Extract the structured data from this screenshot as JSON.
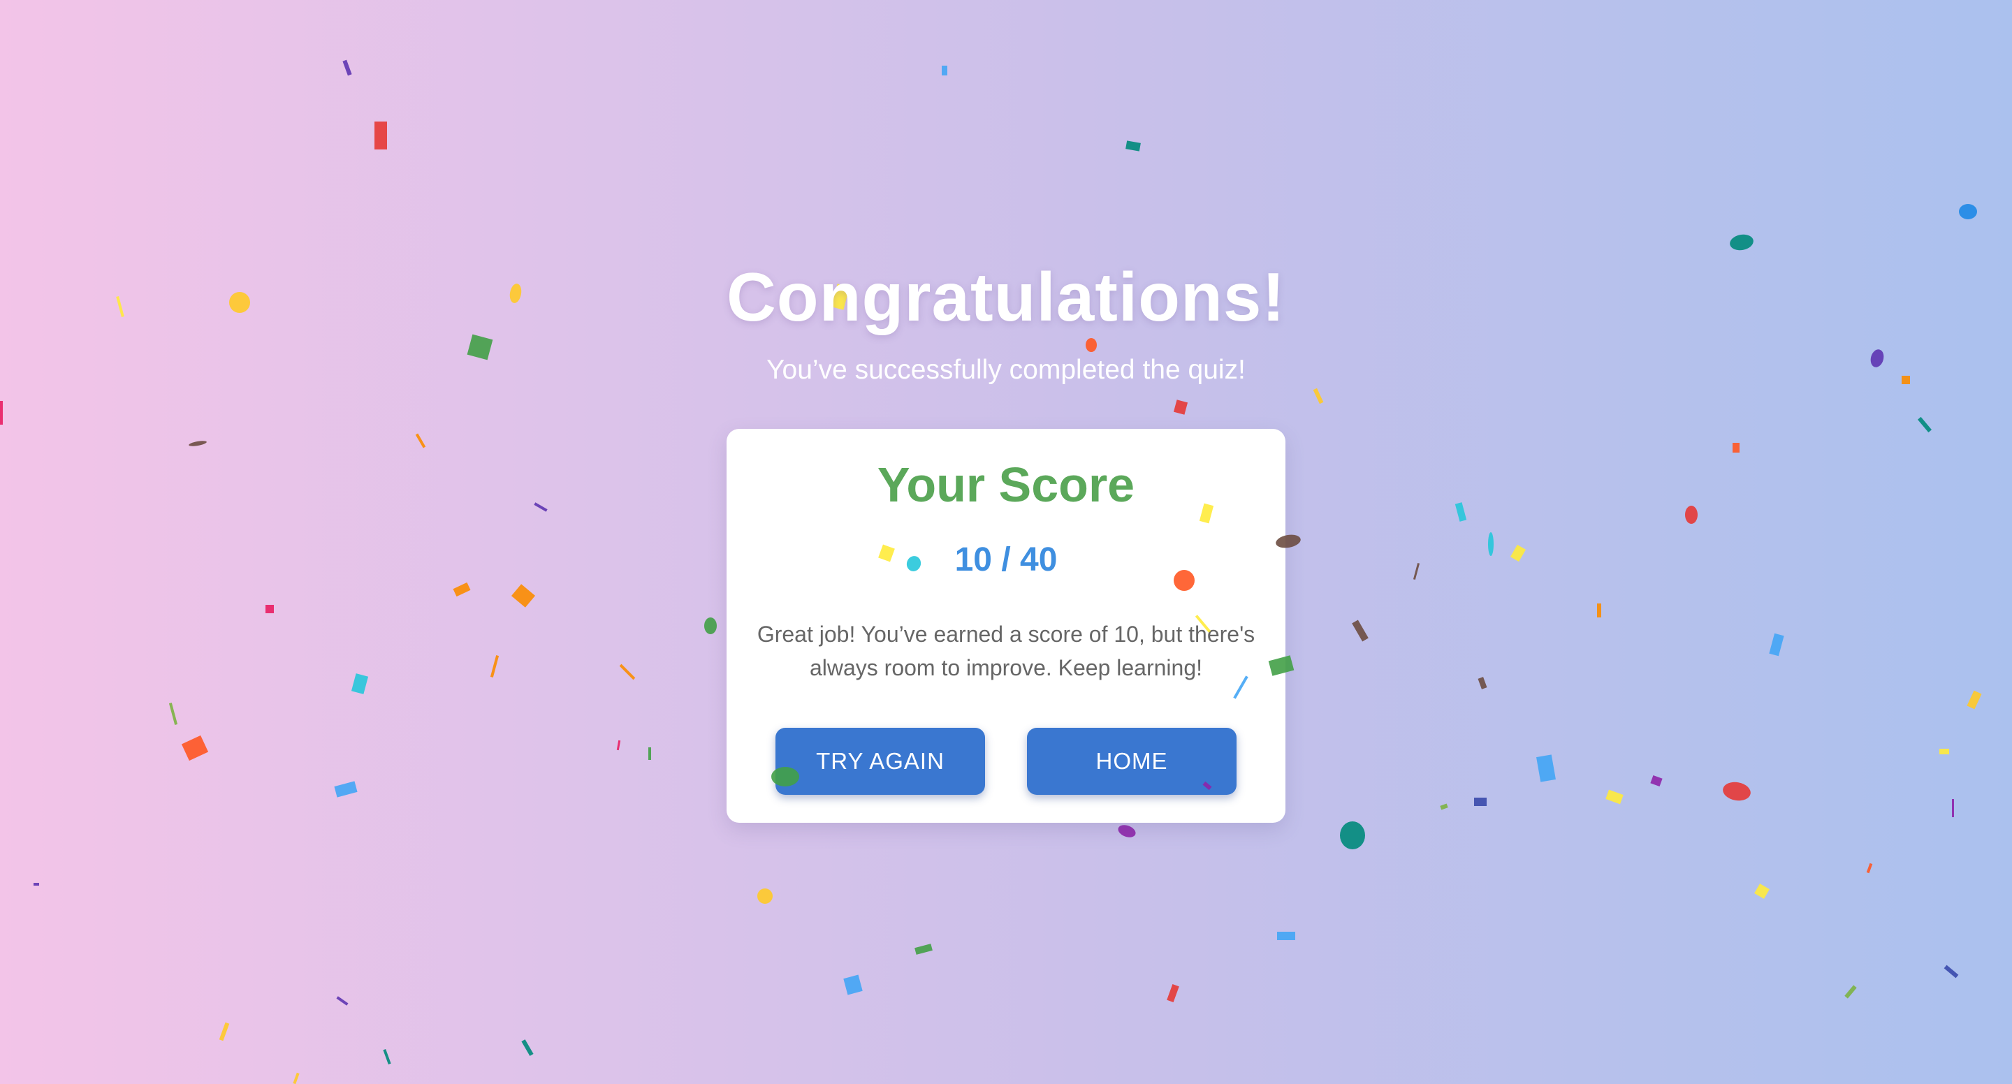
{
  "page": {
    "headline": "Congratulations!",
    "subheadline": "You’ve successfully completed the quiz!"
  },
  "score_card": {
    "title": "Your Score",
    "score": 10,
    "total": 40,
    "score_text": "10 / 40",
    "message": "Great job! You’ve earned a score of 10, but there's always room to improve. Keep learning!"
  },
  "buttons": {
    "try_again_label": "TRY AGAIN",
    "home_label": "HOME"
  },
  "colors": {
    "background_gradient_start": "#f3c4e8",
    "background_gradient_end": "#abc1ee",
    "score_title": "#5ba85a",
    "score_value": "#3f8fe0",
    "button": "#3a77d0",
    "message_text": "#666666"
  },
  "confetti_palette": [
    "#e53935",
    "#ffca28",
    "#43a047",
    "#1e88e5",
    "#8e24aa",
    "#fb8c00",
    "#00897b",
    "#26c6da",
    "#ffeb3b",
    "#6d4c41",
    "#3949ab",
    "#ff5722",
    "#42a5f5",
    "#5e35b1",
    "#7cb342",
    "#e91e63"
  ]
}
